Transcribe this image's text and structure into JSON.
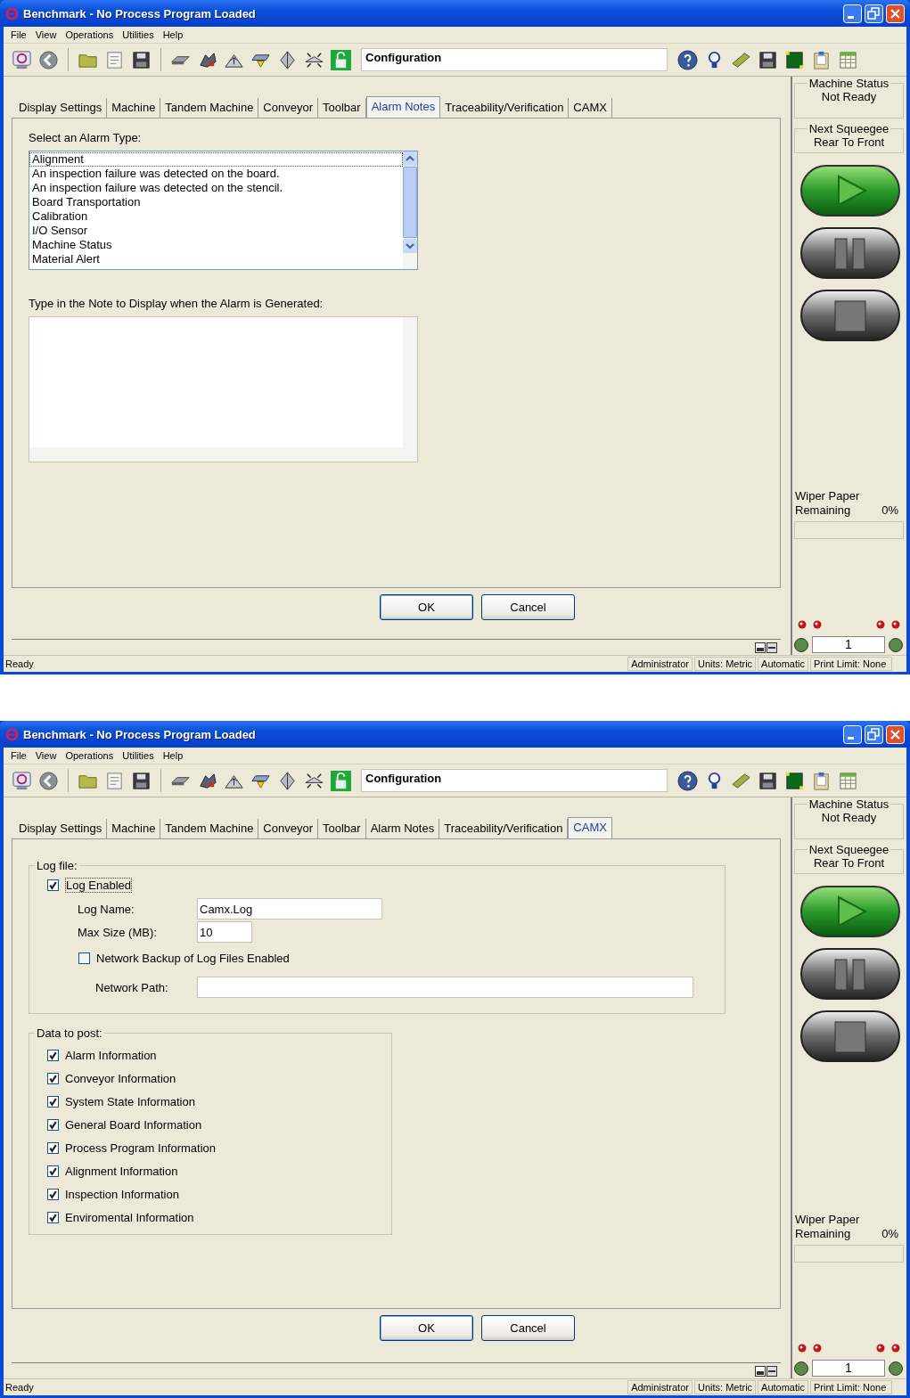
{
  "windows": [
    {
      "title": "Benchmark - No Process Program Loaded",
      "menu": [
        "File",
        "View",
        "Operations",
        "Utilities",
        "Help"
      ],
      "toolbar_field": "Configuration",
      "tabs": [
        {
          "label": "Display Settings",
          "selected": false
        },
        {
          "label": "Machine",
          "selected": false
        },
        {
          "label": "Tandem Machine",
          "selected": false
        },
        {
          "label": "Conveyor",
          "selected": false
        },
        {
          "label": "Toolbar",
          "selected": false
        },
        {
          "label": "Alarm Notes",
          "selected": true
        },
        {
          "label": "Traceability/Verification",
          "selected": false
        },
        {
          "label": "CAMX",
          "selected": false
        }
      ],
      "content": {
        "kind": "alarm_notes",
        "list_label": "Select an Alarm Type:",
        "alarm_types": [
          {
            "label": "Alignment",
            "selected": true
          },
          {
            "label": "An inspection failure was detected on the board.",
            "selected": false
          },
          {
            "label": "An inspection failure was detected on the stencil.",
            "selected": false
          },
          {
            "label": "Board Transportation",
            "selected": false
          },
          {
            "label": "Calibration",
            "selected": false
          },
          {
            "label": "I/O Sensor",
            "selected": false
          },
          {
            "label": "Machine Status",
            "selected": false
          },
          {
            "label": "Material Alert",
            "selected": false
          }
        ],
        "note_label": "Type in the Note to Display when the Alarm is Generated:"
      },
      "buttons": [
        "OK",
        "Cancel"
      ],
      "side": {
        "status_label": "Machine Status",
        "status": "Not Ready",
        "squeegee_label": "Next Squeegee",
        "squeegee": "Rear To Front",
        "wiper": {
          "label": "Wiper Paper",
          "sublabel": "Remaining",
          "reading": "0%",
          "level": 0
        },
        "counter": "1"
      },
      "status": {
        "message": "Ready",
        "panes": [
          "Administrator",
          "Units: Metric",
          "Automatic",
          "Print Limit: None"
        ]
      }
    },
    {
      "title": "Benchmark - No Process Program Loaded",
      "menu": [
        "File",
        "View",
        "Operations",
        "Utilities",
        "Help"
      ],
      "toolbar_field": "Configuration",
      "tabs": [
        {
          "label": "Display Settings",
          "selected": false
        },
        {
          "label": "Machine",
          "selected": false
        },
        {
          "label": "Tandem Machine",
          "selected": false
        },
        {
          "label": "Conveyor",
          "selected": false
        },
        {
          "label": "Toolbar",
          "selected": false
        },
        {
          "label": "Alarm Notes",
          "selected": false
        },
        {
          "label": "Traceability/Verification",
          "selected": false
        },
        {
          "label": "CAMX",
          "selected": true
        }
      ],
      "content": {
        "kind": "camx",
        "log_group": "Log file:",
        "log_enabled": {
          "label": "Log Enabled",
          "checked": true
        },
        "fields": [
          {
            "label": "Log Name:",
            "value": "Camx.Log"
          },
          {
            "label": "Max Size (MB):",
            "value": "10"
          }
        ],
        "backup": {
          "label": "Network Backup of Log Files Enabled",
          "checked": false
        },
        "path_label": "Network Path:",
        "data_group": "Data to post:",
        "data_items": [
          {
            "label": "Alarm Information",
            "checked": true
          },
          {
            "label": "Conveyor Information",
            "checked": true
          },
          {
            "label": "System State Information",
            "checked": true
          },
          {
            "label": "General Board Information",
            "checked": true
          },
          {
            "label": "Process Program Information",
            "checked": true
          },
          {
            "label": "Alignment Information",
            "checked": true
          },
          {
            "label": "Inspection Information",
            "checked": true
          },
          {
            "label": "Enviromental Information",
            "checked": true
          }
        ]
      },
      "buttons": [
        "OK",
        "Cancel"
      ],
      "side": {
        "status_label": "Machine Status",
        "status": "Not Ready",
        "squeegee_label": "Next Squeegee",
        "squeegee": "Rear To Front",
        "wiper": {
          "label": "Wiper Paper",
          "sublabel": "Remaining",
          "reading": "0%",
          "level": 0
        },
        "counter": "1"
      },
      "status": {
        "message": "Ready",
        "panes": [
          "Administrator",
          "Units: Metric",
          "Automatic",
          "Print Limit: None"
        ]
      }
    }
  ]
}
